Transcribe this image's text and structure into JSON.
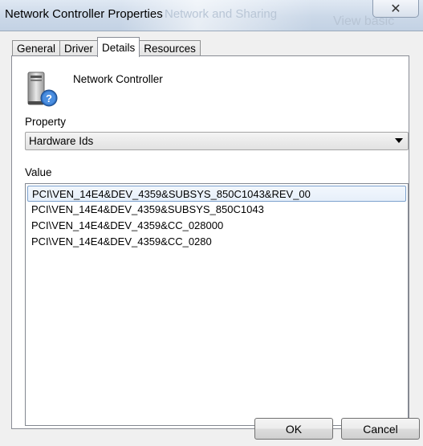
{
  "window": {
    "title": "Network Controller Properties",
    "background_text_1": "Network and Sharing",
    "background_text_2": "View basic"
  },
  "tabs": [
    {
      "label": "General",
      "active": false
    },
    {
      "label": "Driver",
      "active": false
    },
    {
      "label": "Details",
      "active": true
    },
    {
      "label": "Resources",
      "active": false
    }
  ],
  "device": {
    "name": "Network Controller",
    "icon": "unknown-device-icon"
  },
  "property": {
    "label": "Property",
    "selected": "Hardware Ids"
  },
  "value": {
    "label": "Value",
    "items": [
      "PCI\\VEN_14E4&DEV_4359&SUBSYS_850C1043&REV_00",
      "PCI\\VEN_14E4&DEV_4359&SUBSYS_850C1043",
      "PCI\\VEN_14E4&DEV_4359&CC_028000",
      "PCI\\VEN_14E4&DEV_4359&CC_0280"
    ],
    "selected_index": 0
  },
  "buttons": {
    "ok": "OK",
    "cancel": "Cancel"
  }
}
